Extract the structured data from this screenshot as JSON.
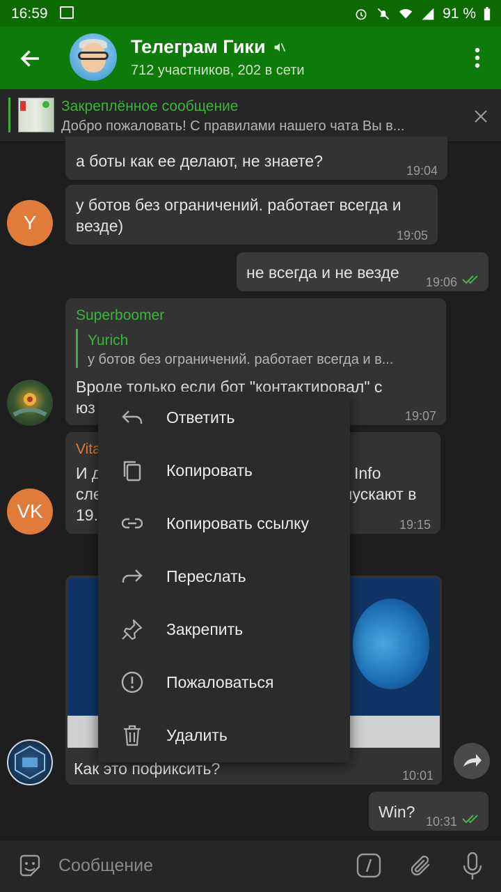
{
  "status_bar": {
    "time": "16:59",
    "battery": "91 %"
  },
  "header": {
    "title": "Телеграм Гики",
    "subtitle": "712 участников, 202 в сети"
  },
  "pinned": {
    "title": "Закреплённое сообщение",
    "text": "Добро пожаловать! С правилами нашего чата Вы в..."
  },
  "messages": [
    {
      "id": "m1",
      "text": "а боты как ее делают, не знаете?",
      "time": "19:04"
    },
    {
      "id": "m2",
      "avatar": "Y",
      "text": "у ботов без ограничений. работает всегда и везде)",
      "time": "19:05"
    },
    {
      "id": "m3",
      "text": "не всегда и не везде",
      "time": "19:06",
      "outgoing": true
    },
    {
      "id": "m4",
      "sender": "Superboomer",
      "reply_name": "Yurich",
      "reply_text": "у ботов без ограничений. работает всегда и в...",
      "text_line1": "Вроде только если бот \"контактировал\" с",
      "text_line2": "юз",
      "time": "19:07"
    },
    {
      "id": "m5",
      "avatar": "VK",
      "sender": "Vita",
      "line1_left": "И д",
      "line1_right": "Info",
      "line2_left": "сле",
      "line2_right": "пускают в",
      "line3_left": "19.",
      "time": "19:15"
    },
    {
      "id": "m6",
      "caption": "Как это пофиксить?",
      "time": "10:01"
    },
    {
      "id": "m7",
      "text": "Win?",
      "time": "10:31",
      "outgoing": true
    }
  ],
  "context_menu": {
    "items": [
      {
        "label": "Ответить",
        "icon": "reply-icon"
      },
      {
        "label": "Копировать",
        "icon": "copy-icon"
      },
      {
        "label": "Копировать ссылку",
        "icon": "link-icon"
      },
      {
        "label": "Переслать",
        "icon": "forward-icon"
      },
      {
        "label": "Закрепить",
        "icon": "pin-icon"
      },
      {
        "label": "Пожаловаться",
        "icon": "report-icon"
      },
      {
        "label": "Удалить",
        "icon": "delete-icon"
      }
    ]
  },
  "input": {
    "placeholder": "Сообщение"
  },
  "colors": {
    "header": "#0e7a0a",
    "statusbar": "#0b6a00",
    "accent_green": "#3bb43b",
    "sender_orange": "#e07b39",
    "background": "#1e1e1e"
  }
}
